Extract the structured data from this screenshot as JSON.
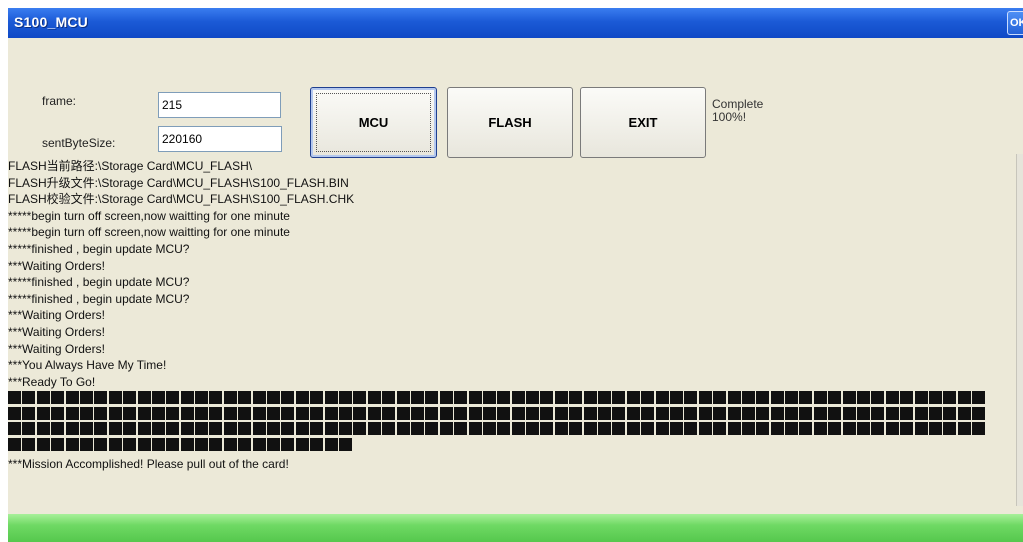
{
  "window": {
    "title": "S100_MCU",
    "close_label": "OK"
  },
  "form": {
    "frame_label": "frame:",
    "frame_value": "215",
    "sent_label": "sentByteSize:",
    "sent_value": "220160"
  },
  "buttons": {
    "mcu": "MCU",
    "flash": "FLASH",
    "exit": "EXIT"
  },
  "status": {
    "line1": "Complete",
    "line2": "100%!"
  },
  "log": [
    "FLASH当前路径:\\Storage Card\\MCU_FLASH\\",
    "FLASH升级文件:\\Storage Card\\MCU_FLASH\\S100_FLASH.BIN",
    "FLASH校验文件:\\Storage Card\\MCU_FLASH\\S100_FLASH.CHK",
    "*****begin turn off screen,now waitting for one minute",
    "*****begin turn off screen,now waitting for one minute",
    "*****finished , begin update MCU?",
    "***Waiting Orders!",
    "*****finished , begin update MCU?",
    "*****finished , begin update MCU?",
    "***Waiting Orders!",
    "***Waiting Orders!",
    "***Waiting Orders!",
    "***You Always Have My Time!",
    "***Ready To Go!"
  ],
  "progress": {
    "blocks_per_row": 68,
    "full_rows": 3,
    "last_row_blocks": 24
  },
  "mission": "***Mission Accomplished! Please pull out of the card!"
}
